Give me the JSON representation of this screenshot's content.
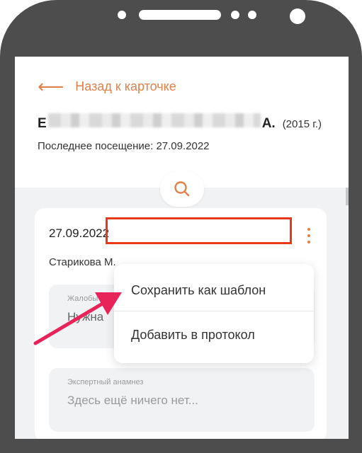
{
  "header": {
    "back_label": "Назад к карточке",
    "patient_name_start": "Е",
    "patient_initial": "А.",
    "patient_year": "(2015 г.)",
    "last_visit": "Последнее посещение: 27.09.2022"
  },
  "icons": {
    "back": "arrow-left-icon",
    "search": "search-icon",
    "kebab": "kebab-menu-icon"
  },
  "visit": {
    "date": "27.09.2022",
    "doctor": "Старикова М.",
    "complaints_label": "Жалобы",
    "complaints_value": "Нужна",
    "anamnesis_label": "Экспертный анамнез",
    "anamnesis_value": "Здесь ещё ничего нет..."
  },
  "menu": {
    "save_template": "Сохранить как шаблон",
    "add_protocol": "Добавить в протокол"
  },
  "colors": {
    "accent": "#e0804a",
    "highlight": "#e8391a",
    "arrow": "#e8235a"
  }
}
